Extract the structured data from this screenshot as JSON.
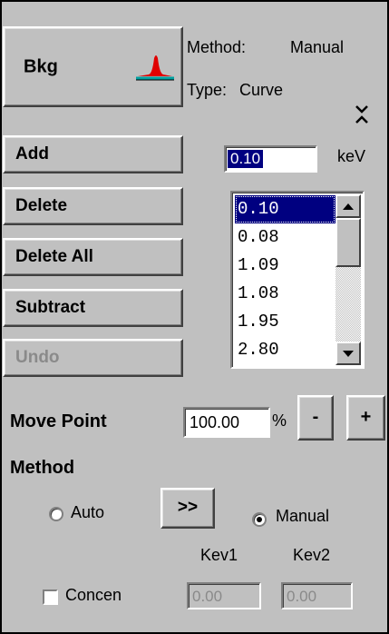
{
  "header": {
    "bkg_label": "Bkg",
    "method_label": "Method:",
    "method_value": "Manual",
    "type_label": "Type:",
    "type_value": "Curve",
    "collapse_glyph": "⌄⌃"
  },
  "actions": {
    "add": "Add",
    "delete": "Delete",
    "delete_all": "Delete All",
    "subtract": "Subtract",
    "undo": "Undo"
  },
  "energy": {
    "value": "0.10",
    "unit": "keV"
  },
  "points_list": {
    "items": [
      "0.10",
      "0.08",
      "1.09",
      "1.08",
      "1.95",
      "2.80"
    ],
    "selected_index": 0
  },
  "move_point": {
    "label": "Move Point",
    "value": "100.00",
    "unit": "%",
    "minus": "-",
    "plus": "+"
  },
  "method_section": {
    "heading": "Method",
    "auto_label": "Auto",
    "toggle_label": ">>",
    "manual_label": "Manual",
    "selected": "Manual"
  },
  "concen": {
    "label": "Concen",
    "checked": false,
    "kev1_label": "Kev1",
    "kev2_label": "Kev2",
    "kev1_value": "0.00",
    "kev2_value": "0.00"
  },
  "colors": {
    "panel_bg": "#c0c0c0",
    "selection_bg": "#000080",
    "peak_red": "#e00000",
    "peak_teal": "#00a0a0"
  }
}
